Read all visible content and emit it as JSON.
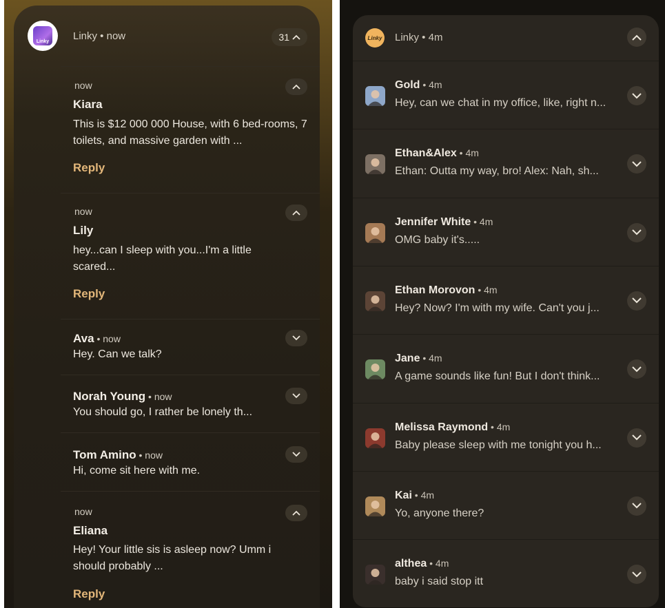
{
  "left": {
    "app_name": "Linky • now",
    "app_icon_text": "Linky",
    "count": "31",
    "expanded": [
      {
        "time": "now",
        "name": "Kiara",
        "text": "This is $12 000 000 House, with 6 bed-rooms, 7 toilets, and massive garden with ...",
        "reply": "Reply"
      },
      {
        "time": "now",
        "name": "Lily",
        "text": "hey...can I sleep with you...I'm a little scared...",
        "reply": "Reply"
      }
    ],
    "collapsed": [
      {
        "name": "Ava",
        "meta": " • now",
        "text": "Hey. Can we talk?"
      },
      {
        "name": "Norah Young",
        "meta": " • now",
        "text": "You should go, I rather be lonely th..."
      },
      {
        "name": "Tom Amino",
        "meta": " • now",
        "text": "Hi, come sit here with me."
      }
    ],
    "last": {
      "time": "now",
      "name": "Eliana",
      "text": "Hey! Your little sis is asleep now? Umm i should probably ...",
      "reply": "Reply"
    }
  },
  "right": {
    "app_name": "Linky • 4m",
    "app_icon_text": "Linky",
    "rows": [
      {
        "name": "Gold",
        "meta": " • 4m",
        "text": "Hey, can we chat in my office, like, right n...",
        "color": "#8ea7c9"
      },
      {
        "name": "Ethan&Alex",
        "meta": " • 4m",
        "text": "Ethan:  Outta my way, bro!  Alex:  Nah, sh...",
        "color": "#7d7064"
      },
      {
        "name": "Jennifer White",
        "meta": " • 4m",
        "text": "OMG baby it's.....",
        "color": "#a57a55"
      },
      {
        "name": "Ethan Morovon",
        "meta": " • 4m",
        "text": "Hey?  Now?  I'm with my wife. Can't you j...",
        "color": "#5c4436"
      },
      {
        "name": "Jane",
        "meta": " • 4m",
        "text": " A game sounds like fun! But I don't think...",
        "color": "#6d8a62"
      },
      {
        "name": "Melissa Raymond",
        "meta": " • 4m",
        "text": "Baby please sleep with me tonight you h...",
        "color": "#8c3a2e"
      },
      {
        "name": "Kai",
        "meta": " • 4m",
        "text": "Yo, anyone there?",
        "color": "#b08a5a"
      },
      {
        "name": "althea",
        "meta": " • 4m",
        "text": "baby i said stop itt",
        "color": "#3a2f2c"
      }
    ]
  }
}
